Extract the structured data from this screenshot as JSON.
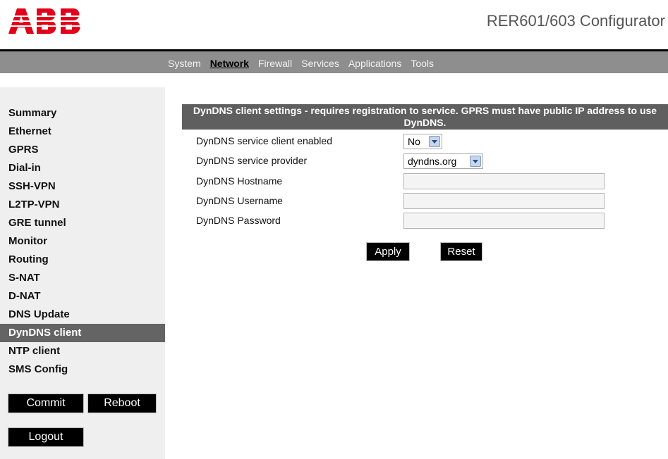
{
  "header": {
    "logo_text": "ABB",
    "app_title": "RER601/603 Configurator",
    "brand_color": "#e2001a"
  },
  "topnav": {
    "items": [
      {
        "label": "System",
        "active": false
      },
      {
        "label": "Network",
        "active": true
      },
      {
        "label": "Firewall",
        "active": false
      },
      {
        "label": "Services",
        "active": false
      },
      {
        "label": "Applications",
        "active": false
      },
      {
        "label": "Tools",
        "active": false
      }
    ]
  },
  "sidebar": {
    "items": [
      {
        "label": "Summary"
      },
      {
        "label": "Ethernet"
      },
      {
        "label": "GPRS"
      },
      {
        "label": "Dial-in"
      },
      {
        "label": "SSH-VPN"
      },
      {
        "label": "L2TP-VPN"
      },
      {
        "label": "GRE tunnel"
      },
      {
        "label": "Monitor"
      },
      {
        "label": "Routing"
      },
      {
        "label": "S-NAT"
      },
      {
        "label": "D-NAT"
      },
      {
        "label": "DNS Update"
      },
      {
        "label": "DynDNS client",
        "active": true
      },
      {
        "label": "NTP client"
      },
      {
        "label": "SMS Config"
      }
    ],
    "commit_label": "Commit",
    "reboot_label": "Reboot",
    "logout_label": "Logout"
  },
  "main": {
    "panel_title": "DynDNS client settings - requires registration to service. GPRS must have public IP address to use DynDNS.",
    "fields": {
      "enabled": {
        "label": "DynDNS service client enabled",
        "value": "No"
      },
      "provider": {
        "label": "DynDNS service provider",
        "value": "dyndns.org"
      },
      "hostname": {
        "label": "DynDNS Hostname",
        "value": ""
      },
      "username": {
        "label": "DynDNS Username",
        "value": ""
      },
      "password": {
        "label": "DynDNS Password",
        "value": ""
      }
    },
    "apply_label": "Apply",
    "reset_label": "Reset"
  },
  "colors": {
    "topbar_bg": "#8e8e8e",
    "panel_header_bg": "#5f5f5f",
    "sidebar_bg": "#efefef",
    "sidebar_active_bg": "#646464"
  }
}
